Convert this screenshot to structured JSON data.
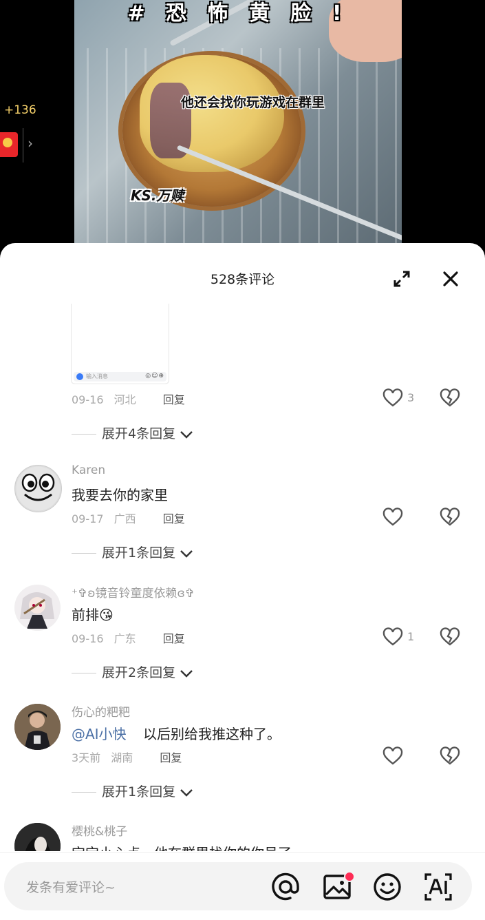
{
  "video": {
    "top_caption": "# 恐 怖 黄 脸 !",
    "mid_caption": "他还会找你玩游戏在群里",
    "watermark": "KS.万赎",
    "side_count": "+136"
  },
  "sheet": {
    "title": "528条评论"
  },
  "thumb": {
    "input_text": "输入消息",
    "icons": "◎☺⊕"
  },
  "comments": [
    {
      "name": "",
      "text": "",
      "date": "09-16",
      "region": "河北",
      "reply": "回复",
      "likes": "3",
      "expand": "展开4条回复"
    },
    {
      "name": "Karen",
      "text": "我要去你的家里",
      "date": "09-17",
      "region": "广西",
      "reply": "回复",
      "likes": "",
      "expand": "展开1条回复"
    },
    {
      "name": "⁺✞ʚ镜音铃童度依赖ɞ✞",
      "text": "前排😘",
      "date": "09-16",
      "region": "广东",
      "reply": "回复",
      "likes": "1",
      "expand": "展开2条回复"
    },
    {
      "name": "伤心的粑粑",
      "mention": "@AI小快",
      "text": "以后别给我推这种了。",
      "date": "3天前",
      "region": "湖南",
      "reply": "回复",
      "likes": "",
      "expand": "展开1条回复"
    },
    {
      "name": "樱桃&桃子",
      "text": "宝宝小心点，他在群里找你的你号了"
    }
  ],
  "bottom_bar": {
    "placeholder": "发条有爱评论~",
    "icons": [
      "at-icon",
      "image-icon",
      "emoji-icon",
      "ai-icon"
    ],
    "accent": "#fe2c55"
  }
}
